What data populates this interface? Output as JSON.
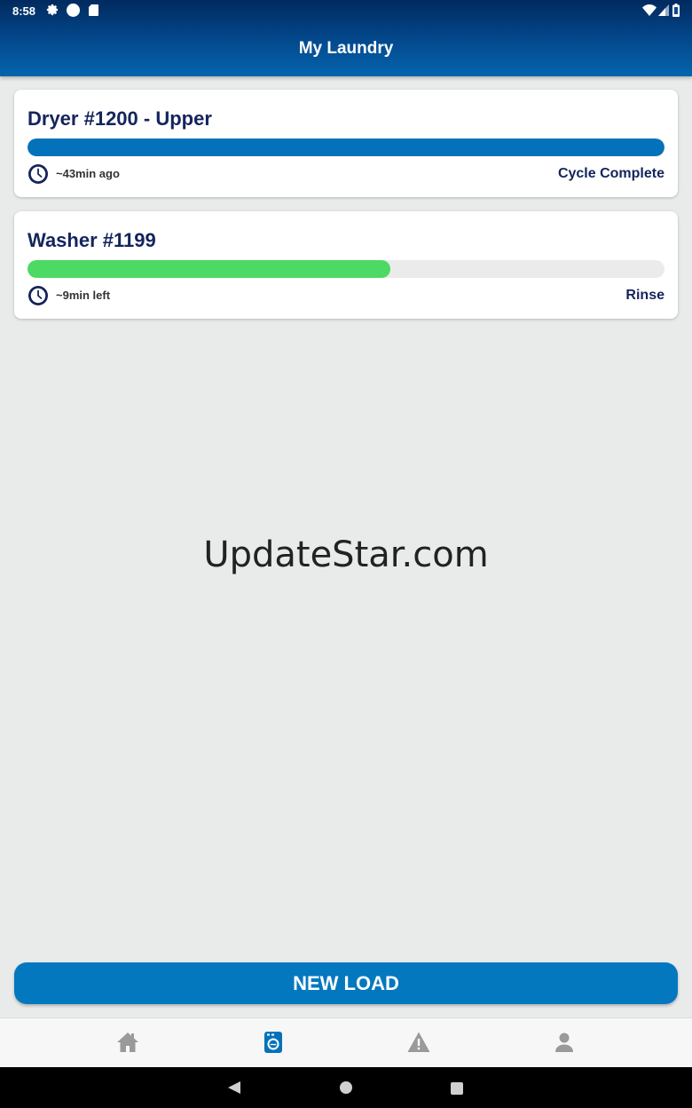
{
  "status_bar": {
    "time": "8:58",
    "icons": [
      "gear-icon",
      "circle-notification-icon",
      "sd-card-icon",
      "wifi-icon",
      "signal-icon",
      "battery-icon"
    ]
  },
  "app_bar": {
    "title": "My Laundry"
  },
  "loads": [
    {
      "title": "Dryer #1200 - Upper",
      "progress": 1.0,
      "bar_color": "#0472bb",
      "time_text": "~43min ago",
      "status": "Cycle Complete"
    },
    {
      "title": "Washer #1199",
      "progress": 0.57,
      "bar_color": "#4cd964",
      "time_text": "~9min left",
      "status": "Rinse"
    }
  ],
  "watermark": "UpdateStar.com",
  "new_load_button": "NEW LOAD",
  "bottom_nav": {
    "items": [
      {
        "icon": "home-icon",
        "active": false
      },
      {
        "icon": "laundry-icon",
        "active": true
      },
      {
        "icon": "alert-icon",
        "active": false
      },
      {
        "icon": "account-icon",
        "active": false
      }
    ],
    "active_color": "#0472bb",
    "inactive_color": "#9a9a9a"
  },
  "colors": {
    "header_dark": "#012a5e",
    "header_light": "#0565ad",
    "title_text": "#14245c",
    "button": "#0478bf",
    "background": "#e9eaea"
  }
}
